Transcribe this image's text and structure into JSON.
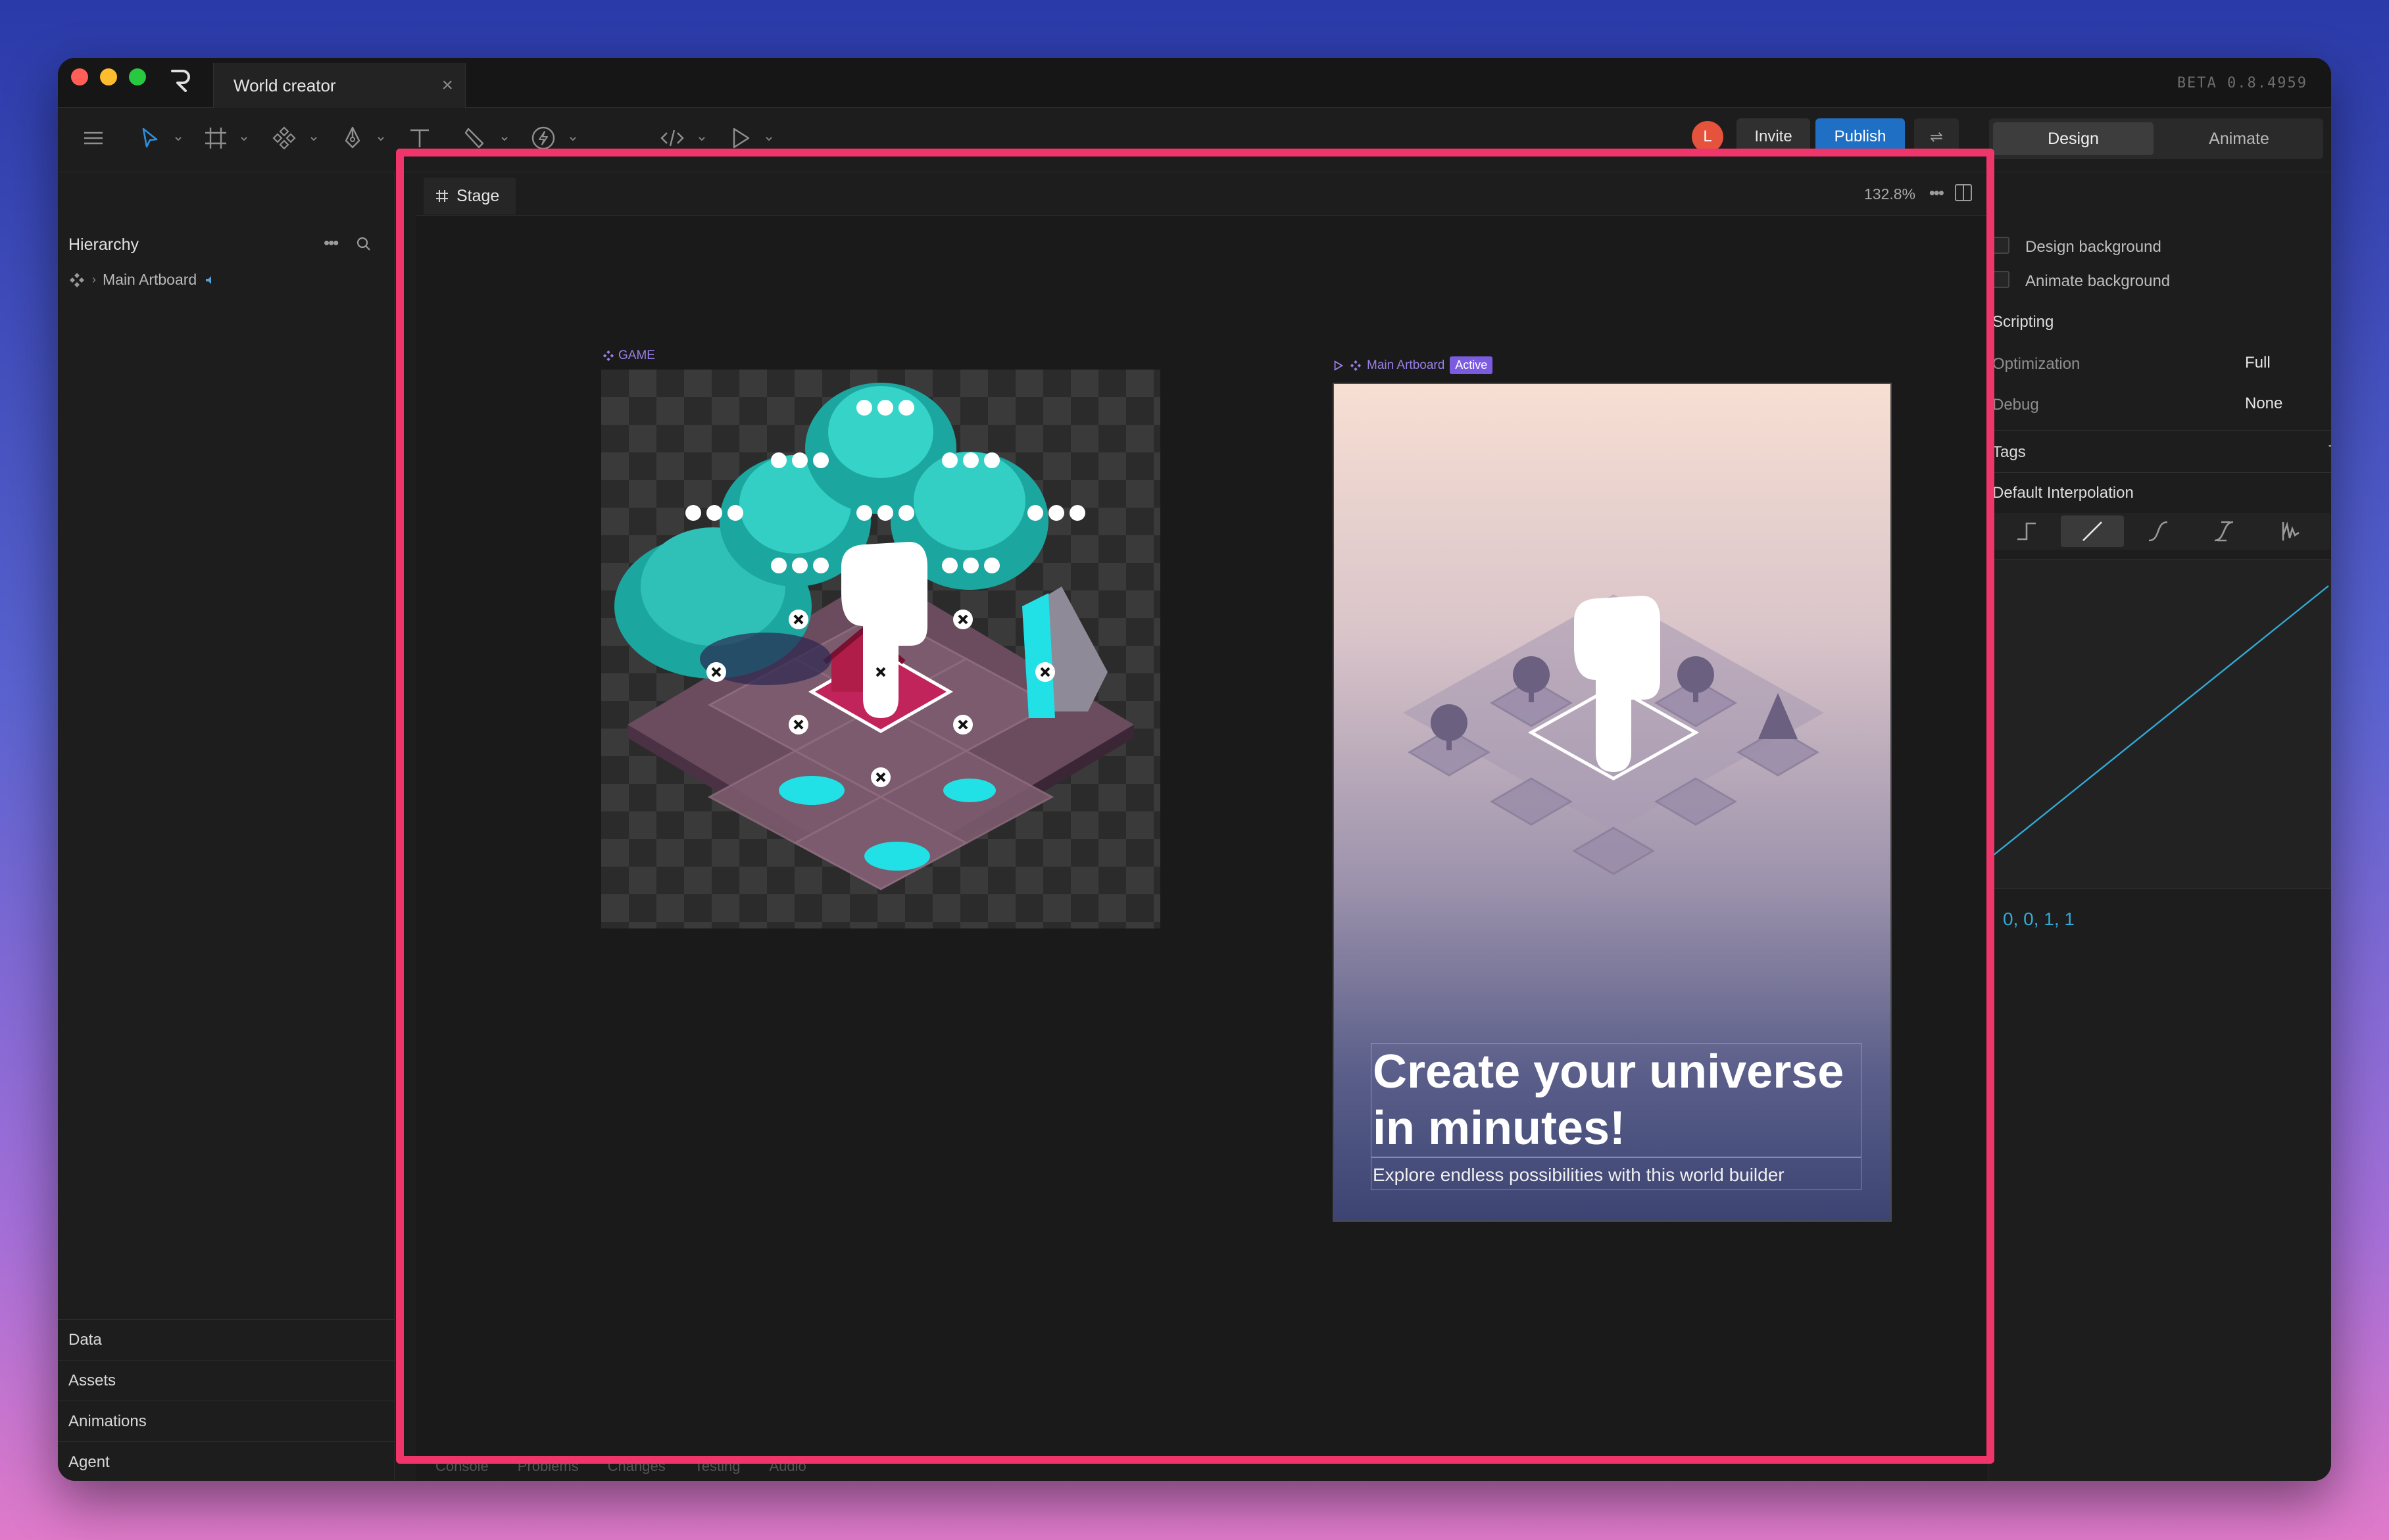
{
  "window": {
    "tab_title": "World creator",
    "tab_close": "×",
    "version": "BETA 0.8.4959"
  },
  "toolbar": {
    "tools": [
      "menu-icon",
      "select-icon",
      "frame-icon",
      "component-icon",
      "pen-icon",
      "text-icon",
      "brush-icon",
      "lightning-icon",
      "code-icon",
      "play-icon"
    ],
    "avatar_initial": "L",
    "invite_label": "Invite",
    "publish_label": "Publish",
    "swap_icon": "⇌",
    "modes": {
      "design": "Design",
      "animate": "Animate"
    },
    "active_mode": "Design",
    "accent": "#1f6fc4"
  },
  "hierarchy": {
    "title": "Hierarchy",
    "more": "•••",
    "items": [
      {
        "label": "Main Artboard"
      }
    ]
  },
  "left_sections": [
    "Data",
    "Assets",
    "Animations",
    "Agent"
  ],
  "stage": {
    "tab_label": "Stage",
    "zoom": "132.8%",
    "more": "•••",
    "game_label": "GAME",
    "artboard_label": "Main Artboard",
    "active_badge": "Active",
    "headline": "Create your universe in minutes!",
    "subline": "Explore endless possibilities with this world builder",
    "bottom_tabs": [
      "Console",
      "Problems",
      "Changes",
      "Testing",
      "Audio"
    ],
    "highlight_color": "#f0356b"
  },
  "right_panel": {
    "design_background": "Design background",
    "animate_background": "Animate background",
    "scripting": "Scripting",
    "optimization_label": "Optimization",
    "optimization_value": "Full",
    "debug_label": "Debug",
    "debug_value": "None",
    "tags_label": "Tags",
    "interp_label": "Default Interpolation",
    "interp_options": [
      "hold",
      "linear",
      "cubic",
      "custom-cubic",
      "elastic"
    ],
    "interp_selected": "linear",
    "curve_values": "0, 0, 1, 1",
    "curve_color": "#33a9d6"
  }
}
